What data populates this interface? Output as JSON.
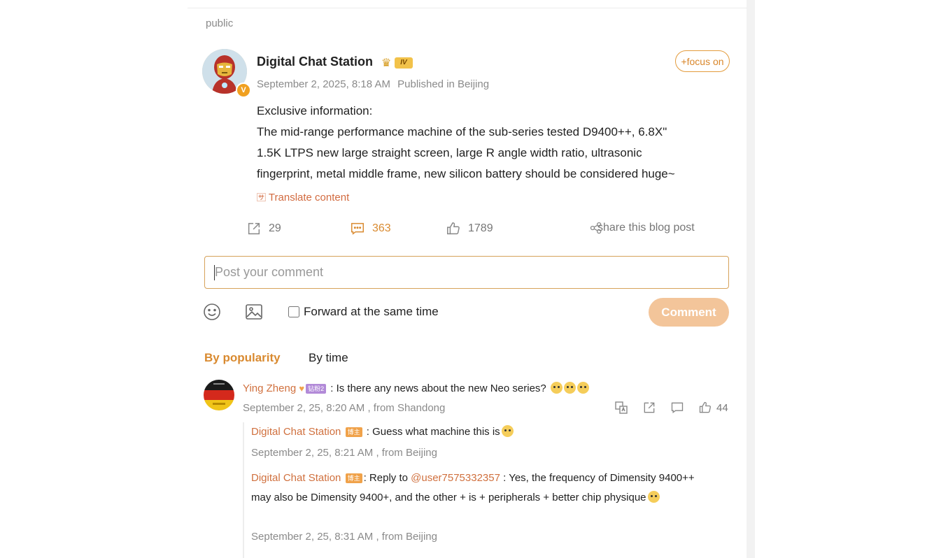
{
  "post": {
    "visibility": "public",
    "author": "Digital Chat Station",
    "level_badge": "IV",
    "verified_mark": "V",
    "date": "September 2, 2025, 8:18 AM",
    "location": "Published in Beijing",
    "follow_label": "+focus on",
    "text_lines": [
      "Exclusive information:",
      "The mid-range performance machine of the sub-series tested D9400++, 6.8X\"",
      "1.5K LTPS new large straight screen, large R angle width ratio, ultrasonic",
      "fingerprint, metal middle frame, new silicon battery should be considered huge~"
    ],
    "translate_label": "Translate content",
    "stats": {
      "reposts": "29",
      "comments": "363",
      "likes": "1789",
      "share_label": "share this blog post"
    }
  },
  "composer": {
    "placeholder": "Post your comment",
    "forward_label": "Forward at the same time",
    "submit_label": "Comment"
  },
  "sort_tabs": {
    "popularity": "By popularity",
    "time": "By time"
  },
  "comments": [
    {
      "user": "Ying Zheng",
      "badge": "钻粉2",
      "text": ": Is there any news about the new Neo series?",
      "meta": "September 2, 25, 8:20 AM , from Shandong",
      "likes": "44",
      "replies": [
        {
          "user": "Digital Chat Station",
          "badge": "博主",
          "text": ": Guess what machine this is",
          "meta": "September 2, 25, 8:21 AM , from Beijing"
        },
        {
          "user": "Digital Chat Station",
          "badge": "博主",
          "prefix": ": Reply to ",
          "mention": "@user7575332357",
          "text": " : Yes, the frequency of Dimensity 9400++ may also be Dimensity 9400+, and the other + is + peripherals + better chip physique",
          "meta": "September 2, 25, 8:31 AM , from Beijing"
        }
      ]
    }
  ],
  "colors": {
    "accent": "#d98a30",
    "username": "#d0703e",
    "button_disabled": "#f3c59a"
  }
}
